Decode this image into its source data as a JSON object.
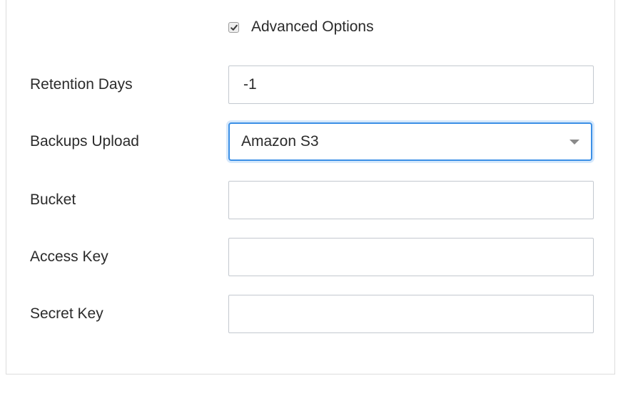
{
  "advanced_options": {
    "label": "Advanced Options",
    "checked": true
  },
  "fields": {
    "retention_days": {
      "label": "Retention Days",
      "value": "-1"
    },
    "backups_upload": {
      "label": "Backups Upload",
      "selected": "Amazon S3"
    },
    "bucket": {
      "label": "Bucket",
      "value": ""
    },
    "access_key": {
      "label": "Access Key",
      "value": ""
    },
    "secret_key": {
      "label": "Secret Key",
      "value": ""
    }
  },
  "colors": {
    "focus_border": "#3b8fe6",
    "input_border": "#c3c8cf",
    "text": "#2b2b2b"
  }
}
